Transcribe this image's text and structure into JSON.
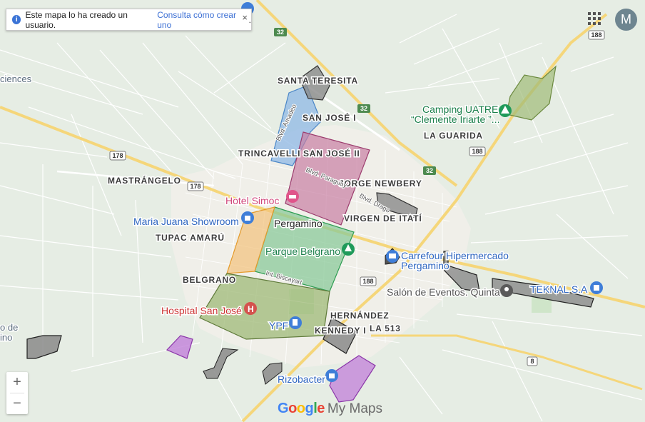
{
  "info": {
    "text": "Este mapa lo ha creado un usuario.",
    "link": "Consulta cómo crear uno",
    "suffix": ".",
    "close": "×"
  },
  "avatar_letter": "M",
  "zoom": {
    "in": "+",
    "out": "−"
  },
  "brand": {
    "g1": "G",
    "g2": "o",
    "g3": "o",
    "g4": "g",
    "g5": "l",
    "g6": "e",
    "mymaps": "My Maps"
  },
  "places": {
    "santa_teresita": "SANTA TERESITA",
    "san_jose_i": "SAN JOSÉ I",
    "trincavelli": "TRINCAVELLI",
    "san_jose_ii": "SAN JOSÉ II",
    "jorge_newbery": "JORGE NEWBERY",
    "mastrangelo": "MASTRÁNGELO",
    "tupac_amaru": "TUPAC AMARÚ",
    "belgrano": "BELGRANO",
    "virgen_itati": "VIRGEN DE ITATÍ",
    "la_guarida": "LA GUARIDA",
    "hernandez": "HERNÁNDEZ",
    "kennedy_i": "KENNEDY I",
    "la_513": "LA 513",
    "pergamino": "Pergamino",
    "ciences": "ciences",
    "left_de": "o de",
    "left_ino": "ino"
  },
  "pois": {
    "hotel": "Hotel Simoc",
    "maria_juana": "Maria Juana Showroom",
    "parque_belgrano": "Parque Belgrano",
    "hospital": "Hospital San José",
    "ypf": "YPF",
    "carrefour_1": "Carrefour Hipermercado",
    "carrefour_2": "Pergamino",
    "salon": "Salón de Eventos. Quinta",
    "teknal": "TEKNAL S.A",
    "camping_1": "Camping UATRE",
    "camping_2": "“Clemente Iriarte ”...",
    "rizobacter": "Rizobacter"
  },
  "streets": {
    "amadeo": "Blvd. Amadeo",
    "paraguay": "Blvd. Paraguay",
    "drago": "Blvd. Drago",
    "biscayart": "Int. Biscayart"
  },
  "routes": {
    "r32a": "32",
    "r32b": "32",
    "r32c": "32",
    "r178a": "178",
    "r178b": "178",
    "r188a": "188",
    "r188b": "188",
    "r188c": "188",
    "r8": "8"
  },
  "colors": {
    "blue_zone": "#8fb8e6",
    "pink_zone": "#c77fa3",
    "green_zone": "#8bc99a",
    "orange_zone": "#f2c27a",
    "olive_zone": "#9fba77",
    "gray_zone": "#8a8a8a",
    "purple_zone": "#c27fd9",
    "poi_blue": "#3f7ed8",
    "poi_green": "#1f9a5a",
    "poi_red": "#d4524e"
  }
}
